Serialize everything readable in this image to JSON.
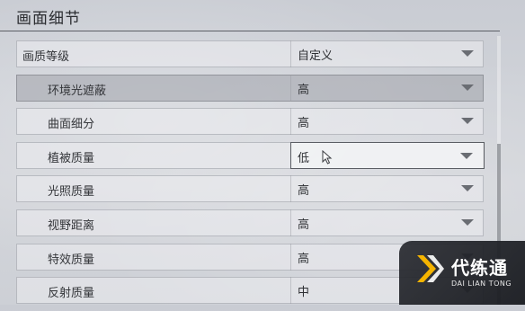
{
  "section": {
    "title": "画面细节"
  },
  "settings": [
    {
      "label": "画质等级",
      "value": "自定义",
      "indent": false,
      "highlight": false,
      "focused": false
    },
    {
      "label": "环境光遮蔽",
      "value": "高",
      "indent": true,
      "highlight": true,
      "focused": false
    },
    {
      "label": "曲面细分",
      "value": "高",
      "indent": true,
      "highlight": false,
      "focused": false
    },
    {
      "label": "植被质量",
      "value": "低",
      "indent": true,
      "highlight": false,
      "focused": true
    },
    {
      "label": "光照质量",
      "value": "高",
      "indent": true,
      "highlight": false,
      "focused": false
    },
    {
      "label": "视野距离",
      "value": "高",
      "indent": true,
      "highlight": false,
      "focused": false
    },
    {
      "label": "特效质量",
      "value": "高",
      "indent": true,
      "highlight": false,
      "focused": false
    },
    {
      "label": "反射质量",
      "value": "中",
      "indent": true,
      "highlight": false,
      "focused": false
    }
  ],
  "icons": {
    "dropdown": "chevron-down-icon",
    "cursor": "mouse-cursor-icon",
    "logo": "dailiantong-logo-icon"
  },
  "watermark": {
    "name_cn": "代练通",
    "name_en": "DAI LIAN TONG"
  },
  "colors": {
    "logo_accent": "#f5b400",
    "logo_dark": "#202228"
  }
}
